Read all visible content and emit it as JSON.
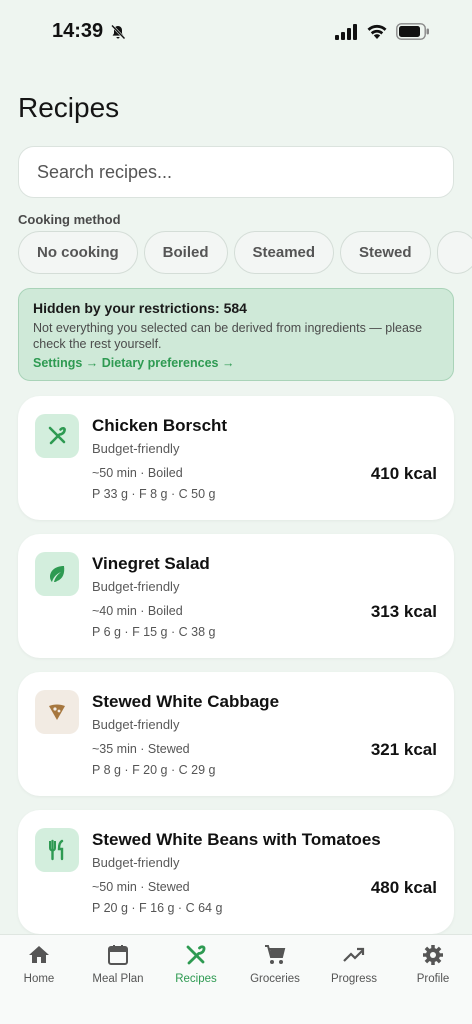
{
  "status_bar": {
    "time": "14:39"
  },
  "page": {
    "title": "Recipes"
  },
  "search": {
    "placeholder": "Search recipes..."
  },
  "filters": {
    "label": "Cooking method",
    "chips": [
      "No cooking",
      "Boiled",
      "Steamed",
      "Stewed"
    ]
  },
  "notice": {
    "title": "Hidden by your restrictions: 584",
    "text": "Not everything you selected can be derived from ingredients — please check the rest yourself.",
    "link": "Settings → Dietary preferences →"
  },
  "recipes": [
    {
      "title": "Chicken Borscht",
      "tag": "Budget-friendly",
      "meta": "~50 min · Boiled",
      "macros": "P 33 g · F 8 g · C 50 g",
      "kcal": "410 kcal",
      "icon": "fork-knife-icon",
      "icon_color": "#2e9a52"
    },
    {
      "title": "Vinegret Salad",
      "tag": "Budget-friendly",
      "meta": "~40 min · Boiled",
      "macros": "P 6 g · F 15 g · C 38 g",
      "kcal": "313 kcal",
      "icon": "leaf-icon",
      "icon_color": "#2e9a52"
    },
    {
      "title": "Stewed White Cabbage",
      "tag": "Budget-friendly",
      "meta": "~35 min · Stewed",
      "macros": "P 8 g · F 20 g · C 29 g",
      "kcal": "321 kcal",
      "icon": "pizza-slice-icon",
      "icon_color": "#a6773f"
    },
    {
      "title": "Stewed White Beans with Tomatoes",
      "tag": "Budget-friendly",
      "meta": "~50 min · Stewed",
      "macros": "P 20 g · F 16 g · C 64 g",
      "kcal": "480 kcal",
      "icon": "utensils-icon",
      "icon_color": "#2e9a52"
    }
  ],
  "tabs": [
    {
      "label": "Home",
      "icon": "home-icon"
    },
    {
      "label": "Meal Plan",
      "icon": "calendar-icon"
    },
    {
      "label": "Recipes",
      "icon": "fork-knife-icon",
      "active": true
    },
    {
      "label": "Groceries",
      "icon": "cart-icon"
    },
    {
      "label": "Progress",
      "icon": "trending-up-icon"
    },
    {
      "label": "Profile",
      "icon": "gear-icon"
    }
  ],
  "colors": {
    "accent": "#2e9a52",
    "background": "#eef5f0",
    "notice_bg": "#cfe9d8"
  }
}
